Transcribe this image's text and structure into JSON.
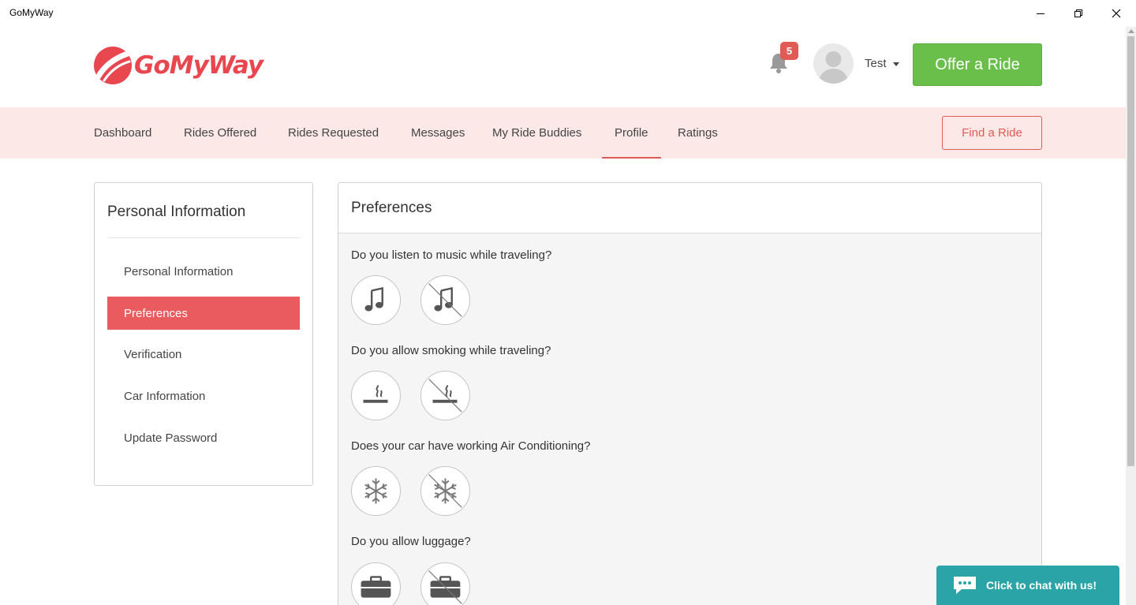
{
  "window": {
    "title": "GoMyWay"
  },
  "header": {
    "logo_text": "GoMyWay",
    "notification_count": "5",
    "user_name": "Test",
    "offer_ride_label": "Offer a Ride"
  },
  "nav": {
    "items": [
      "Dashboard",
      "Rides Offered",
      "Rides Requested",
      "Messages",
      "My Ride Buddies",
      "Profile",
      "Ratings"
    ],
    "active": "Profile",
    "find_ride_label": "Find a Ride"
  },
  "sidebar": {
    "title": "Personal Information",
    "items": [
      "Personal Information",
      "Preferences",
      "Verification",
      "Car Information",
      "Update Password"
    ],
    "active": "Preferences"
  },
  "main": {
    "title": "Preferences",
    "questions": [
      {
        "text": "Do you listen to music while traveling?",
        "yes_icon": "music-icon",
        "no_icon": "no-music-icon"
      },
      {
        "text": "Do you allow smoking while traveling?",
        "yes_icon": "smoking-icon",
        "no_icon": "no-smoking-icon"
      },
      {
        "text": "Does your car have working Air Conditioning?",
        "yes_icon": "snowflake-icon",
        "no_icon": "no-snowflake-icon"
      },
      {
        "text": "Do you allow luggage?",
        "yes_icon": "luggage-icon",
        "no_icon": "no-luggage-icon"
      }
    ]
  },
  "chat": {
    "label": "Click to chat with us!"
  },
  "colors": {
    "brand_red": "#e8474f",
    "accent_red": "#e25a56",
    "nav_bg": "#fde8e8",
    "offer_green": "#6abf4b",
    "chat_teal": "#2ba4a8"
  }
}
